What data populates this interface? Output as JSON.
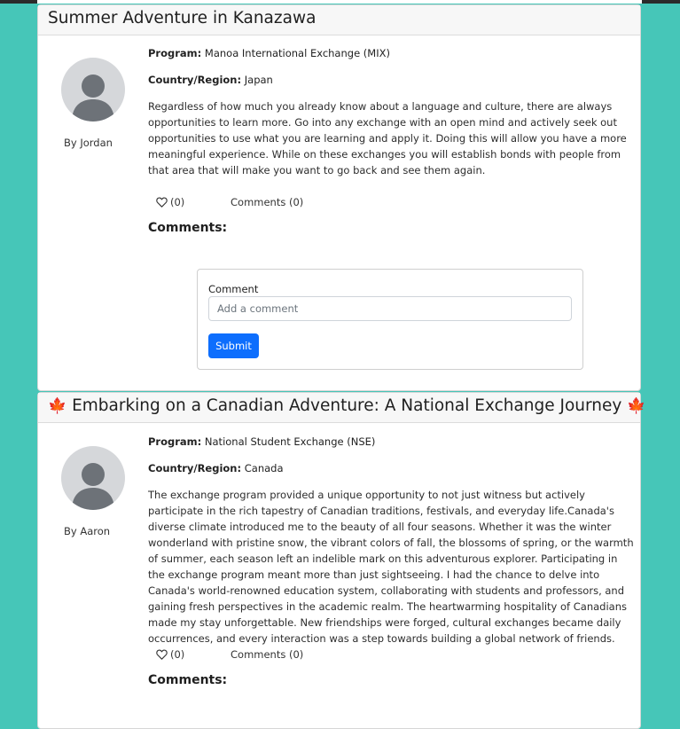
{
  "posts": [
    {
      "title": "Summer Adventure in Kanazawa",
      "author": "By Jordan",
      "program_label": "Program:",
      "program": "Manoa International Exchange (MIX)",
      "country_label": "Country/Region:",
      "country": "Japan",
      "body": "Regardless of how much you already know about a language and culture, there are always opportunities to learn more. Go into any exchange with an open mind and actively seek out opportunities to use what you are learning and apply it. Doing this will allow you have a more meaningful experience. While on these exchanges you will establish bonds with people from that area that will make you want to go back and see them again.",
      "likes": "(0)",
      "comments_link": "Comments (0)",
      "comments_heading": "Comments:",
      "form": {
        "label": "Comment",
        "placeholder": "Add a comment",
        "submit": "Submit"
      }
    },
    {
      "title": "Embarking on a Canadian Adventure: A National Exchange Journey",
      "title_emoji": "🍁",
      "author": "By Aaron",
      "program_label": "Program:",
      "program": "National Student Exchange (NSE)",
      "country_label": "Country/Region:",
      "country": "Canada",
      "body": "The exchange program provided a unique opportunity to not just witness but actively participate in the rich tapestry of Canadian traditions, festivals, and everyday life.Canada's diverse climate introduced me to the beauty of all four seasons. Whether it was the winter wonderland with pristine snow, the vibrant colors of fall, the blossoms of spring, or the warmth of summer, each season left an indelible mark on this adventurous explorer. Participating in the exchange program meant more than just sightseeing. I had the chance to delve into Canada's world-renowned education system, collaborating with students and professors, and gaining fresh perspectives in the academic realm. The heartwarming hospitality of Canadians made my stay unforgettable. New friendships were forged, cultural exchanges became daily occurrences, and every interaction was a step towards building a global network of friends.",
      "likes": "(0)",
      "comments_link": "Comments (0)",
      "comments_heading": "Comments:"
    }
  ],
  "colors": {
    "page_background": "#46c6b8",
    "submit_button": "#0d6efd"
  },
  "icons": {
    "avatar": "user-silhouette-icon",
    "like": "heart-outline-icon",
    "title_emoji": "maple-leaf"
  }
}
